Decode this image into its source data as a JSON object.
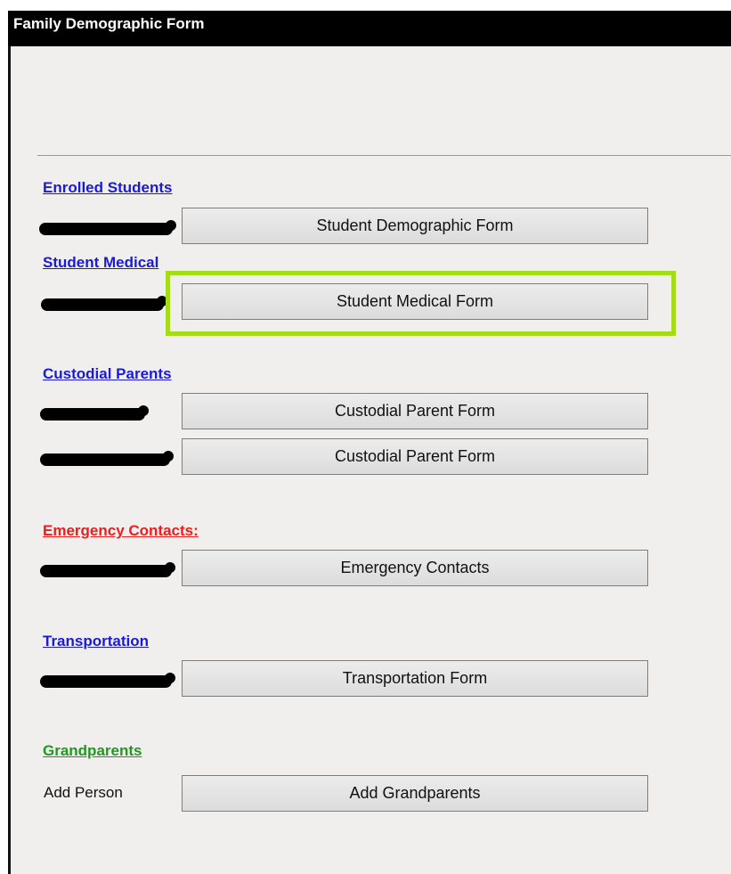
{
  "window": {
    "title": "Family Demographic Form"
  },
  "sections": {
    "enrolled_students": {
      "heading": "Enrolled Students",
      "button": "Student Demographic Form"
    },
    "student_medical": {
      "heading": "Student Medical",
      "button": "Student Medical Form"
    },
    "custodial_parents": {
      "heading": "Custodial Parents",
      "buttons": [
        "Custodial Parent Form",
        "Custodial Parent Form"
      ]
    },
    "emergency_contacts": {
      "heading": "Emergency Contacts:",
      "button": "Emergency Contacts"
    },
    "transportation": {
      "heading": "Transportation",
      "button": "Transportation Form"
    },
    "grandparents": {
      "heading": "Grandparents",
      "row_label": "Add Person",
      "button": "Add Grandparents"
    }
  },
  "colors": {
    "link_blue": "#1a1adc",
    "link_red": "#ee1c1c",
    "link_green": "#1e9a1e",
    "highlight": "#a4dc18"
  }
}
